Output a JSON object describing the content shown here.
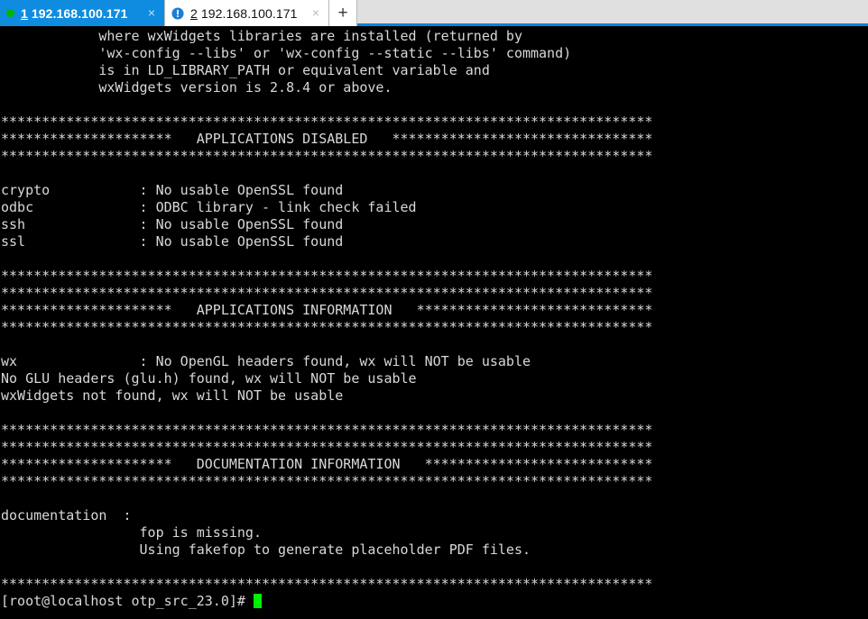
{
  "tab_bar": {
    "tabs": [
      {
        "index": "1",
        "title": "192.168.100.171",
        "state": "connected",
        "icon": "green-status-dot-icon",
        "close_glyph": "×",
        "active": true
      },
      {
        "index": "2",
        "title": "192.168.100.171",
        "state": "warning",
        "icon": "blue-exclamation-icon",
        "close_glyph": "×",
        "active": false
      }
    ],
    "new_tab_label": "+",
    "accent_color": "#0f8ce0",
    "active_tab_bg": "#0f8ce0",
    "inactive_tab_bg": "#ffffff",
    "bar_bg": "#e0e0e0",
    "status_dot_color": "#00b400"
  },
  "terminal": {
    "background_color": "#000000",
    "foreground_color": "#d8d8d8",
    "cursor_color": "#00ee00",
    "prompt": "[root@localhost otp_src_23.0]#",
    "rule_80": "********************************************************************************",
    "lines": [
      "            where wxWidgets libraries are installed (returned by",
      "            'wx-config --libs' or 'wx-config --static --libs' command)",
      "            is in LD_LIBRARY_PATH or equivalent variable and",
      "            wxWidgets version is 2.8.4 or above.",
      "",
      "********************************************************************************",
      "*********************   APPLICATIONS DISABLED   ********************************",
      "********************************************************************************",
      "",
      "crypto           : No usable OpenSSL found",
      "odbc             : ODBC library - link check failed",
      "ssh              : No usable OpenSSL found",
      "ssl              : No usable OpenSSL found",
      "",
      "********************************************************************************",
      "********************************************************************************",
      "*********************   APPLICATIONS INFORMATION   *****************************",
      "********************************************************************************",
      "",
      "wx               : No OpenGL headers found, wx will NOT be usable",
      "No GLU headers (glu.h) found, wx will NOT be usable",
      "wxWidgets not found, wx will NOT be usable",
      "",
      "********************************************************************************",
      "********************************************************************************",
      "*********************   DOCUMENTATION INFORMATION   ****************************",
      "********************************************************************************",
      "",
      "documentation  :",
      "                 fop is missing.",
      "                 Using fakefop to generate placeholder PDF files.",
      "",
      "********************************************************************************"
    ]
  }
}
